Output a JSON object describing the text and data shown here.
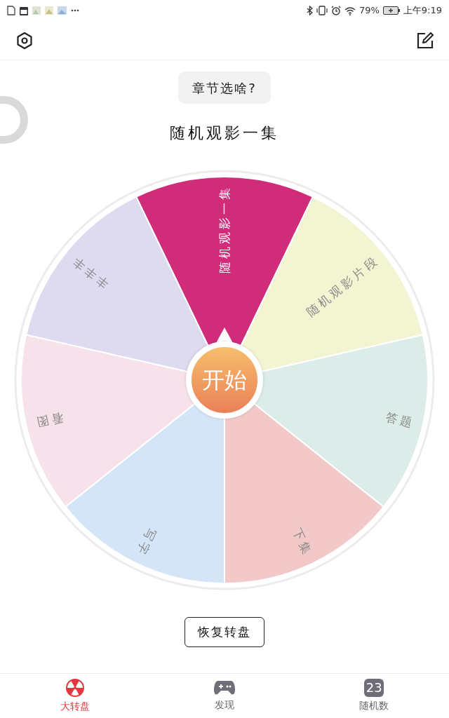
{
  "status_bar": {
    "battery": "79%",
    "time": "上午9:19"
  },
  "header": {
    "topic_button": "章节选啥?",
    "result": "随机观影一集"
  },
  "wheel": {
    "start_button": "开始",
    "segments": [
      {
        "label": "随机观影一集",
        "color": "#d02c7a"
      },
      {
        "label": "随机观影片段",
        "color": "#f3f4d2"
      },
      {
        "label": "答题",
        "color": "#dcece9"
      },
      {
        "label": "下集",
        "color": "#f2c9c8"
      },
      {
        "label": "写字",
        "color": "#d3e5f7"
      },
      {
        "label": "看图",
        "color": "#f7e1ea"
      },
      {
        "label": "丰丰丰",
        "color": "#dedaf0"
      }
    ]
  },
  "reset_button": "恢复转盘",
  "tabs": [
    {
      "label": "大转盘",
      "selected": true,
      "kind": "wheel"
    },
    {
      "label": "发现",
      "selected": false,
      "kind": "gamepad"
    },
    {
      "label": "随机数",
      "selected": false,
      "kind": "number",
      "badge": "23"
    }
  ]
}
